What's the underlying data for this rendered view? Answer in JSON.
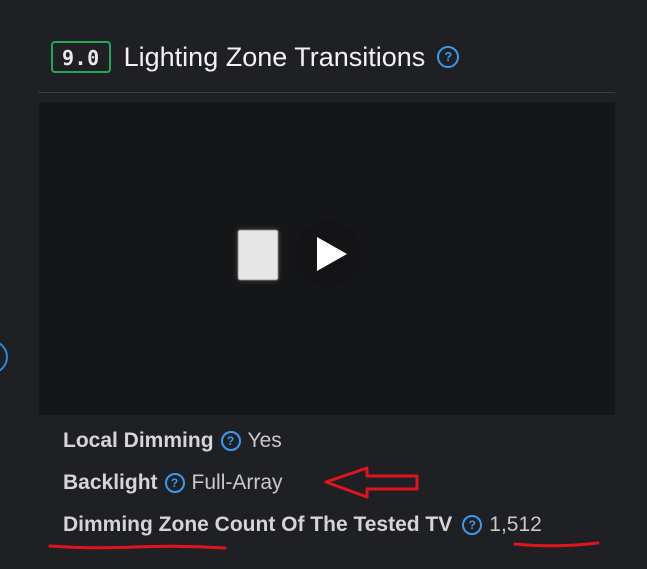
{
  "header": {
    "score": "9.0",
    "title": "Lighting Zone Transitions",
    "help_glyph": "?"
  },
  "video": {
    "play_icon": "play-icon"
  },
  "specs": [
    {
      "label": "Local Dimming",
      "value": "Yes"
    },
    {
      "label": "Backlight",
      "value": "Full-Array"
    },
    {
      "label": "Dimming Zone Count Of The Tested TV",
      "value": "1,512"
    }
  ],
  "colors": {
    "background": "#1f2023",
    "badge_border": "#23a85a",
    "help_icon": "#3b9af0",
    "annotation": "#e0141e"
  }
}
